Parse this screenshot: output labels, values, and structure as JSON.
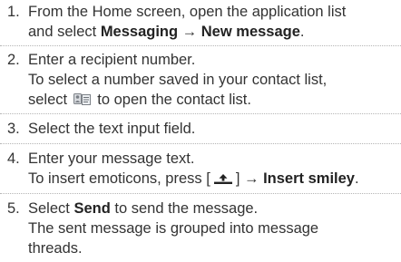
{
  "steps": [
    {
      "number": "1.",
      "line1": "From the Home screen, open the application list",
      "line2_prefix": "and select ",
      "line2_bold1": "Messaging",
      "line2_arrow": " → ",
      "line2_bold2": "New message",
      "line2_suffix": "."
    },
    {
      "number": "2.",
      "line1": "Enter a recipient number.",
      "line2": "To select a number saved in your contact list,",
      "line3_prefix": "select ",
      "line3_suffix": " to open the contact list."
    },
    {
      "number": "3.",
      "line1": "Select the text input field."
    },
    {
      "number": "4.",
      "line1": "Enter your message text.",
      "line2_prefix": "To insert emoticons, press [",
      "line2_mid": "] → ",
      "line2_bold": "Insert smiley",
      "line2_suffix": "."
    },
    {
      "number": "5.",
      "line1_prefix": "Select ",
      "line1_bold": "Send",
      "line1_suffix": " to send the message.",
      "line2": "The sent message is grouped into message",
      "line3": "threads."
    }
  ],
  "icons": {
    "contact_list": "contact-list-icon",
    "menu_key": "menu-key-icon"
  },
  "colors": {
    "text": "#333333",
    "divider": "#b5b5b5"
  }
}
